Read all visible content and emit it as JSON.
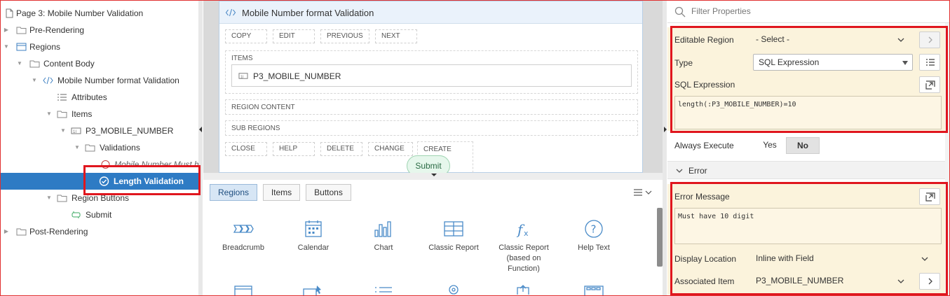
{
  "tree": {
    "nodes": [
      {
        "label": "Page 3: Mobile Number Validation",
        "icon": "page-icon"
      },
      {
        "label": "Pre-Rendering",
        "icon": "folder-icon"
      },
      {
        "label": "Regions",
        "icon": "regions-icon"
      },
      {
        "label": "Content Body",
        "icon": "folder-icon"
      },
      {
        "label": "Mobile Number format Validation",
        "icon": "code-icon"
      },
      {
        "label": "Attributes",
        "icon": "attributes-icon"
      },
      {
        "label": "Items",
        "icon": "folder-icon"
      },
      {
        "label": "P3_MOBILE_NUMBER",
        "icon": "text-item-icon"
      },
      {
        "label": "Validations",
        "icon": "folder-icon"
      },
      {
        "label": "Mobile Number Must h",
        "icon": "error-check-icon"
      },
      {
        "label": "Length Validation",
        "icon": "check-circle-icon"
      },
      {
        "label": "Region Buttons",
        "icon": "folder-icon"
      },
      {
        "label": "Submit",
        "icon": "button-icon"
      },
      {
        "label": "Post-Rendering",
        "icon": "folder-icon"
      }
    ]
  },
  "layout": {
    "region_title": "Mobile Number format Validation",
    "top_buttons": [
      "COPY",
      "EDIT",
      "PREVIOUS",
      "NEXT"
    ],
    "items_label": "ITEMS",
    "item_chip": "P3_MOBILE_NUMBER",
    "region_content_label": "REGION CONTENT",
    "sub_regions_label": "SUB REGIONS",
    "bottom_buttons": [
      "CLOSE",
      "HELP",
      "DELETE",
      "CHANGE",
      "CREATE"
    ],
    "submit_label": "Submit"
  },
  "gallery": {
    "tabs": [
      "Regions",
      "Items",
      "Buttons"
    ],
    "active_tab": "Regions",
    "items": [
      "Breadcrumb",
      "Calendar",
      "Chart",
      "Classic Report",
      "Classic Report (based on Function)",
      "Help Text"
    ]
  },
  "props": {
    "filter_placeholder": "Filter Properties",
    "editable_region": {
      "label": "Editable Region",
      "value": "- Select -"
    },
    "type": {
      "label": "Type",
      "value": "SQL Expression"
    },
    "sql_expression": {
      "label": "SQL Expression",
      "value": "length(:P3_MOBILE_NUMBER)=10"
    },
    "always_execute": {
      "label": "Always Execute",
      "yes": "Yes",
      "no": "No"
    },
    "error_section": "Error",
    "error_message": {
      "label": "Error Message",
      "value": "Must have 10 digit"
    },
    "display_location": {
      "label": "Display Location",
      "value": "Inline with Field"
    },
    "associated_item": {
      "label": "Associated Item",
      "value": "P3_MOBILE_NUMBER"
    }
  },
  "colors": {
    "selected_row": "#2e7bc4",
    "highlight_border": "#e0161e",
    "property_bg": "#fbf3dc"
  }
}
